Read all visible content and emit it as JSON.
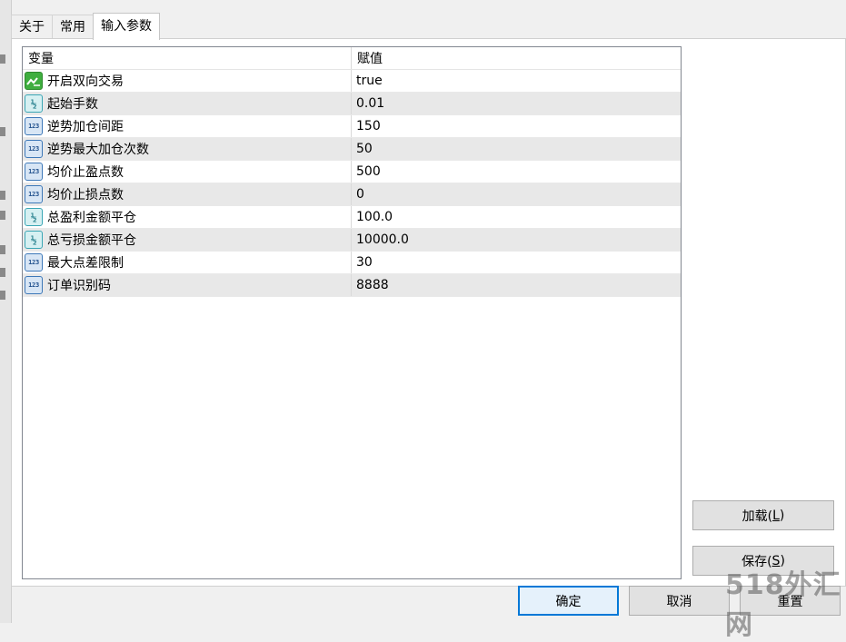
{
  "tabs": [
    {
      "label": "关于",
      "active": false
    },
    {
      "label": "常用",
      "active": false
    },
    {
      "label": "输入参数",
      "active": true
    }
  ],
  "grid": {
    "columns": {
      "name": "变量",
      "value": "赋值"
    },
    "rows": [
      {
        "icon": "bool-icon",
        "name": "开启双向交易",
        "value": "true"
      },
      {
        "icon": "double-icon",
        "name": "起始手数",
        "value": "0.01"
      },
      {
        "icon": "int-icon",
        "name": "逆势加仓间距",
        "value": "150"
      },
      {
        "icon": "int-icon",
        "name": "逆势最大加仓次数",
        "value": "50"
      },
      {
        "icon": "int-icon",
        "name": "均价止盈点数",
        "value": "500"
      },
      {
        "icon": "int-icon",
        "name": "均价止损点数",
        "value": "0"
      },
      {
        "icon": "double-icon",
        "name": "总盈利金额平仓",
        "value": "100.0"
      },
      {
        "icon": "double-icon",
        "name": "总亏损金额平仓",
        "value": "10000.0"
      },
      {
        "icon": "int-icon",
        "name": "最大点差限制",
        "value": "30"
      },
      {
        "icon": "int-icon",
        "name": "订单识别码",
        "value": "8888"
      }
    ]
  },
  "icons": {
    "int_glyph": "123",
    "double_glyph": "½"
  },
  "buttons": {
    "load": {
      "label": "加载(",
      "accel": "L",
      "suffix": ")"
    },
    "save": {
      "label": "保存(",
      "accel": "S",
      "suffix": ")"
    },
    "ok": {
      "label": "确定"
    },
    "cancel": {
      "label": "取消"
    },
    "reset": {
      "label": "重置"
    }
  },
  "watermark": "518外汇网",
  "colors": {
    "accent": "#0078d7",
    "row_alt": "#e8e8e8",
    "bool_icon": "#3fae3f",
    "int_icon": "#3d78b8",
    "double_icon": "#3aa6b5"
  }
}
